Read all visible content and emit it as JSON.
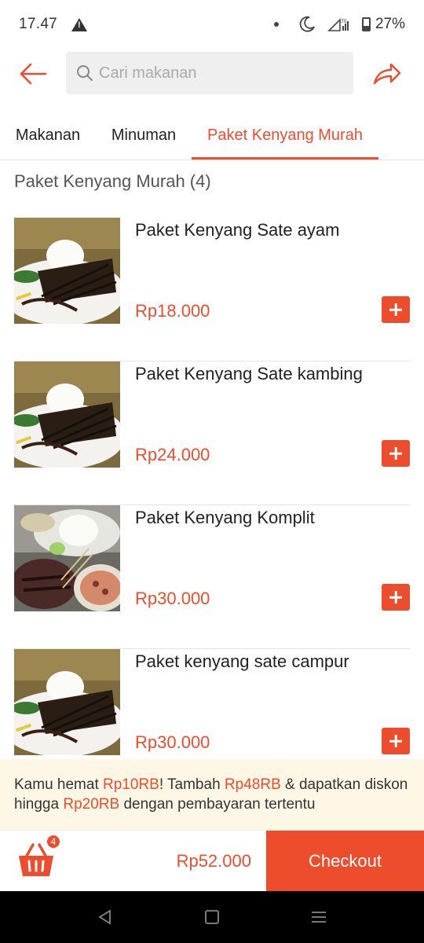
{
  "status_bar": {
    "time": "17.47",
    "battery": "27%",
    "icons": [
      "warning-icon",
      "moon-icon",
      "lte-icon",
      "signal-icon",
      "battery-icon"
    ]
  },
  "header": {
    "search_placeholder": "Cari makanan",
    "icons": [
      "back-arrow-icon",
      "search-icon",
      "share-icon"
    ]
  },
  "tabs": [
    {
      "label": "Makanan",
      "active": false
    },
    {
      "label": "Minuman",
      "active": false
    },
    {
      "label": "Paket Kenyang Murah",
      "active": true
    }
  ],
  "section": {
    "title": "Paket Kenyang Murah (4)"
  },
  "items": [
    {
      "name": "Paket Kenyang Sate ayam",
      "price": "Rp18.000"
    },
    {
      "name": "Paket Kenyang Sate kambing",
      "price": "Rp24.000"
    },
    {
      "name": "Paket Kenyang Komplit",
      "price": "Rp30.000"
    },
    {
      "name": "Paket kenyang sate campur",
      "price": "Rp30.000"
    }
  ],
  "promo": {
    "p1": "Kamu hemat ",
    "save": "Rp10RB",
    "p2": "! Tambah ",
    "add": "Rp48RB",
    "p3": " & dapatkan diskon hingga ",
    "discount": "Rp20RB",
    "p4": " dengan pembayaran tertentu"
  },
  "cart": {
    "count": "4",
    "total": "Rp52.000",
    "checkout_label": "Checkout"
  },
  "colors": {
    "accent": "#ee4d2d",
    "promo_bg": "#fff7e6"
  }
}
